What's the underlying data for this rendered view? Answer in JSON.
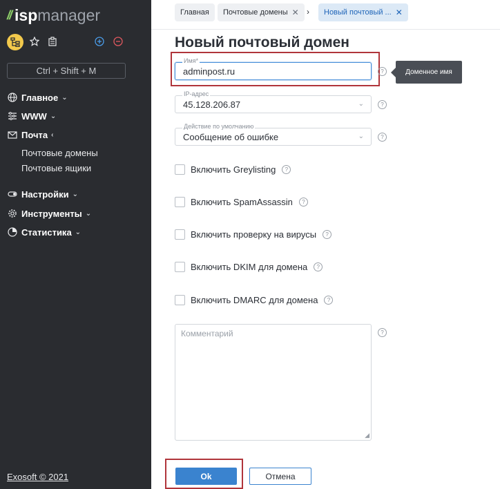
{
  "brand": {
    "prefix": "isp",
    "name": "manager"
  },
  "colors": {
    "sidebar": "#2a2c30",
    "accent": "#3a83cf",
    "highlight": "#b0343a",
    "logo_green": "#8fd26a"
  },
  "toolbar": {
    "icons": [
      "sitemap-icon",
      "star-icon",
      "clipboard-icon",
      "add-circle-icon",
      "remove-circle-icon"
    ]
  },
  "sidebar": {
    "search_label": "Ctrl + Shift + M",
    "items": [
      {
        "label": "Главное",
        "icon": "globe-icon",
        "chevron": "⌄"
      },
      {
        "label": "WWW",
        "icon": "sliders-icon",
        "chevron": "⌄"
      },
      {
        "label": "Почта",
        "icon": "mail-icon",
        "chevron": "‹"
      },
      {
        "label": "Настройки",
        "icon": "toggle-icon",
        "chevron": "⌄"
      },
      {
        "label": "Инструменты",
        "icon": "gear-icon",
        "chevron": "⌄"
      },
      {
        "label": "Статистика",
        "icon": "pie-chart-icon",
        "chevron": "⌄"
      }
    ],
    "mail_sub": [
      "Почтовые домены",
      "Почтовые ящики"
    ],
    "footer": "Exosoft © 2021"
  },
  "breadcrumbs": {
    "items": [
      "Главная",
      "Почтовые домены",
      "Новый почтовый ..."
    ],
    "separator": "›"
  },
  "form": {
    "title": "Новый почтовый домен",
    "name": {
      "label": "Имя*",
      "value": "adminpost.ru"
    },
    "tooltip": "Доменное имя",
    "ip": {
      "label": "IP-адрес",
      "value": "45.128.206.87"
    },
    "action": {
      "label": "Действие по умолчанию",
      "value": "Сообщение об ошибке"
    },
    "checkboxes": [
      {
        "label": "Включить Greylisting",
        "checked": false
      },
      {
        "label": "Включить SpamAssassin",
        "checked": false
      },
      {
        "label": "Включить проверку на вирусы",
        "checked": false
      },
      {
        "label": "Включить DKIM для домена",
        "checked": false
      },
      {
        "label": "Включить DMARC для домена",
        "checked": false
      }
    ],
    "comment_placeholder": "Комментарий",
    "ok_label": "Ok",
    "cancel_label": "Отмена",
    "help_glyph": "?"
  }
}
